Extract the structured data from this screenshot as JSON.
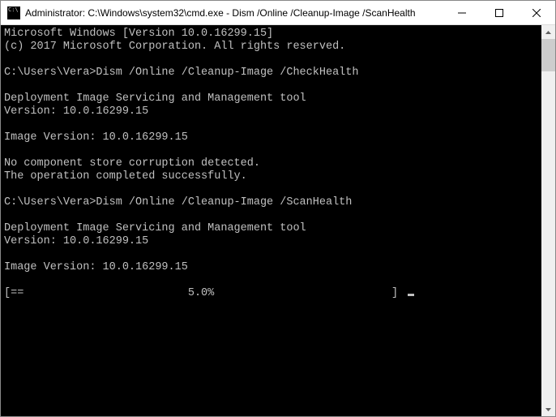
{
  "titlebar": {
    "title": "Administrator: C:\\Windows\\system32\\cmd.exe - Dism  /Online /Cleanup-Image /ScanHealth"
  },
  "console": {
    "lines": [
      "Microsoft Windows [Version 10.0.16299.15]",
      "(c) 2017 Microsoft Corporation. All rights reserved.",
      "",
      "C:\\Users\\Vera>Dism /Online /Cleanup-Image /CheckHealth",
      "",
      "Deployment Image Servicing and Management tool",
      "Version: 10.0.16299.15",
      "",
      "Image Version: 10.0.16299.15",
      "",
      "No component store corruption detected.",
      "The operation completed successfully.",
      "",
      "C:\\Users\\Vera>Dism /Online /Cleanup-Image /ScanHealth",
      "",
      "Deployment Image Servicing and Management tool",
      "Version: 10.0.16299.15",
      "",
      "Image Version: 10.0.16299.15",
      ""
    ],
    "progress_line": "[==                         5.0%                           ] ",
    "progress_percent": 5.0
  },
  "colors": {
    "console_bg": "#000000",
    "console_fg": "#c0c0c0",
    "titlebar_bg": "#ffffff"
  }
}
